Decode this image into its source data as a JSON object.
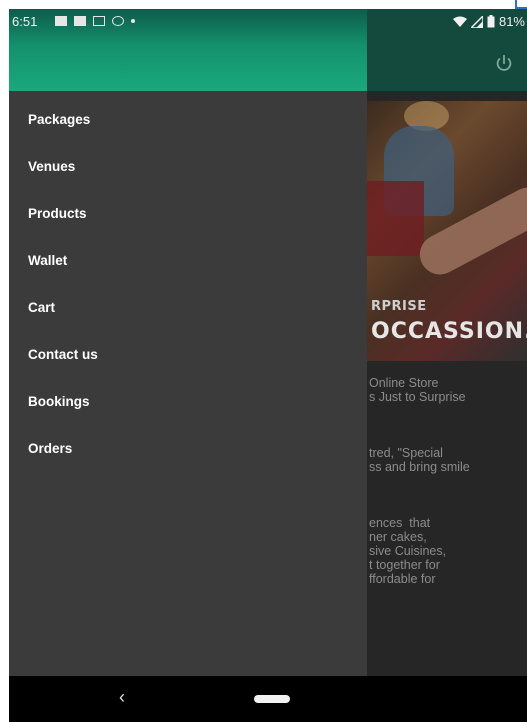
{
  "status_bar": {
    "time": "6:51",
    "battery": "81%",
    "icons": [
      "message-icon",
      "calendar-icon",
      "app-icon",
      "network-icon",
      "dot-icon",
      "wifi-icon",
      "signal-icon",
      "battery-icon"
    ]
  },
  "drawer": {
    "menu": [
      {
        "label": "Packages"
      },
      {
        "label": "Venues"
      },
      {
        "label": "Products"
      },
      {
        "label": "Wallet"
      },
      {
        "label": "Cart"
      },
      {
        "label": "Contact us"
      },
      {
        "label": "Bookings"
      },
      {
        "label": "Orders"
      }
    ]
  },
  "background": {
    "hero_tag_1": "RPRISE",
    "hero_tag_2": "OCCASSION.",
    "para1": "Online Store\ns Just to Surprise",
    "para2": "tred, \"Special\nss and bring smile",
    "para3": "ences  that\nner cakes,\nsive Cuisines,\nt together for\nffordable for"
  },
  "colors": {
    "drawer_bg": "#3b3b3b",
    "header_gradient_top": "#0d5b4a",
    "header_gradient_bottom": "#1aa87b",
    "appbar_dimmed": "#14493e"
  }
}
